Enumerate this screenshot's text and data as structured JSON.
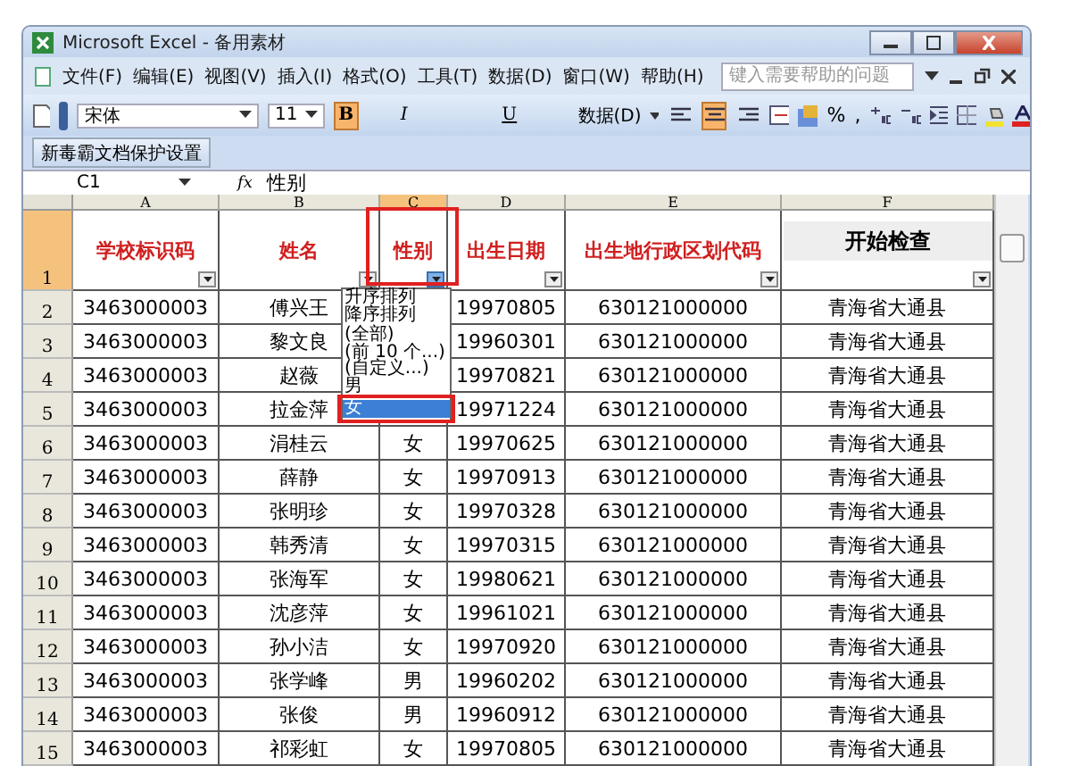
{
  "window": {
    "title": "Microsoft Excel - 备用素材"
  },
  "menu": [
    "文件(F)",
    "编辑(E)",
    "视图(V)",
    "插入(I)",
    "格式(O)",
    "工具(T)",
    "数据(D)",
    "窗口(W)",
    "帮助(H)"
  ],
  "help_search": {
    "placeholder": "键入需要帮助的问题"
  },
  "toolbar": {
    "font": "宋体",
    "size": "11",
    "format_buttons": [
      {
        "label": "B",
        "selected": true
      },
      {
        "label": "I",
        "selected": false
      },
      {
        "label": "U",
        "selected": false
      }
    ],
    "data_menu": "数据(D)",
    "align": [
      {
        "selected": false
      },
      {
        "selected": true
      },
      {
        "selected": false
      }
    ],
    "percent": "%",
    "comma": ","
  },
  "toolbar2": {
    "button": "新毒霸文档保护设置"
  },
  "formula_bar": {
    "name_box": "C1",
    "fx": "fx",
    "value": "性别"
  },
  "columns": [
    {
      "letter": "A",
      "header": "学校标识码",
      "selected": false,
      "filter_active": false
    },
    {
      "letter": "B",
      "header": "姓名",
      "selected": false,
      "filter_active": false
    },
    {
      "letter": "C",
      "header": "性别",
      "selected": true,
      "filter_active": true
    },
    {
      "letter": "D",
      "header": "出生日期",
      "selected": false,
      "filter_active": false
    },
    {
      "letter": "E",
      "header": "出生地行政区划代码",
      "selected": false,
      "filter_active": false
    },
    {
      "letter": "F",
      "selected": false,
      "filter_active": false
    }
  ],
  "header_row": {
    "number": "1",
    "selected": true
  },
  "rows": [
    {
      "number": "2",
      "cells": [
        "3463000003",
        "傅兴王",
        null,
        "19970805",
        "630121000000",
        "青海省大通县"
      ]
    },
    {
      "number": "3",
      "cells": [
        "3463000003",
        "黎文良",
        null,
        "19960301",
        "630121000000",
        "青海省大通县"
      ]
    },
    {
      "number": "4",
      "cells": [
        "3463000003",
        "赵薇",
        null,
        "19970821",
        "630121000000",
        "青海省大通县"
      ]
    },
    {
      "number": "5",
      "cells": [
        "3463000003",
        "拉金萍",
        null,
        "19971224",
        "630121000000",
        "青海省大通县"
      ]
    },
    {
      "number": "6",
      "cells": [
        "3463000003",
        "涓桂云",
        "女",
        "19970625",
        "630121000000",
        "青海省大通县"
      ]
    },
    {
      "number": "7",
      "cells": [
        "3463000003",
        "薛静",
        "女",
        "19970913",
        "630121000000",
        "青海省大通县"
      ]
    },
    {
      "number": "8",
      "cells": [
        "3463000003",
        "张明珍",
        "女",
        "19970328",
        "630121000000",
        "青海省大通县"
      ]
    },
    {
      "number": "9",
      "cells": [
        "3463000003",
        "韩秀清",
        "女",
        "19970315",
        "630121000000",
        "青海省大通县"
      ]
    },
    {
      "number": "10",
      "cells": [
        "3463000003",
        "张海军",
        "女",
        "19980621",
        "630121000000",
        "青海省大通县"
      ]
    },
    {
      "number": "11",
      "cells": [
        "3463000003",
        "沈彦萍",
        "女",
        "19961021",
        "630121000000",
        "青海省大通县"
      ]
    },
    {
      "number": "12",
      "cells": [
        "3463000003",
        "孙小洁",
        "女",
        "19970920",
        "630121000000",
        "青海省大通县"
      ]
    },
    {
      "number": "13",
      "cells": [
        "3463000003",
        "张学峰",
        "男",
        "19960202",
        "630121000000",
        "青海省大通县"
      ]
    },
    {
      "number": "14",
      "cells": [
        "3463000003",
        "张俊",
        "男",
        "19960912",
        "630121000000",
        "青海省大通县"
      ]
    },
    {
      "number": "15",
      "cells": [
        "3463000003",
        "祁彩虹",
        "女",
        "19970805",
        "630121000000",
        "青海省大通县"
      ]
    }
  ],
  "filter_dropdown": {
    "items": [
      {
        "label": "升序排列",
        "selected": false
      },
      {
        "label": "降序排列",
        "selected": false
      },
      {
        "label": "(全部)",
        "selected": false
      },
      {
        "label": "(前 10 个...)",
        "selected": false
      },
      {
        "label": "(自定义...)",
        "selected": false
      },
      {
        "label": "男",
        "selected": false
      },
      {
        "label": "女",
        "selected": true
      }
    ]
  },
  "check_button": {
    "label": "开始检查"
  }
}
